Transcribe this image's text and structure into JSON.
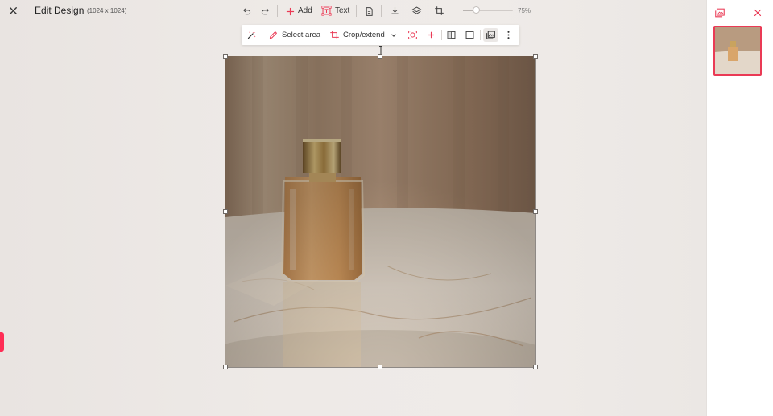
{
  "header": {
    "title": "Edit Design",
    "dimensions": "(1024 x 1024)"
  },
  "toolbar": {
    "add_label": "Add",
    "text_label": "Text",
    "zoom_label": "75%",
    "zoom_value": 0.25,
    "accent_color": "#ea3a55"
  },
  "image_toolbar": {
    "select_area_label": "Select area",
    "crop_label": "Crop/extend"
  },
  "icons": [
    "close-icon",
    "undo-icon",
    "redo-icon",
    "plus-icon",
    "text-frame-icon",
    "page-icon",
    "download-icon",
    "layers-icon",
    "crop-icon",
    "magic-wand-icon",
    "pencil-icon",
    "chevron-down-icon",
    "face-scan-icon",
    "flip-horizontal-icon",
    "flip-vertical-icon",
    "image-stack-icon",
    "more-vertical-icon",
    "gallery-icon"
  ]
}
